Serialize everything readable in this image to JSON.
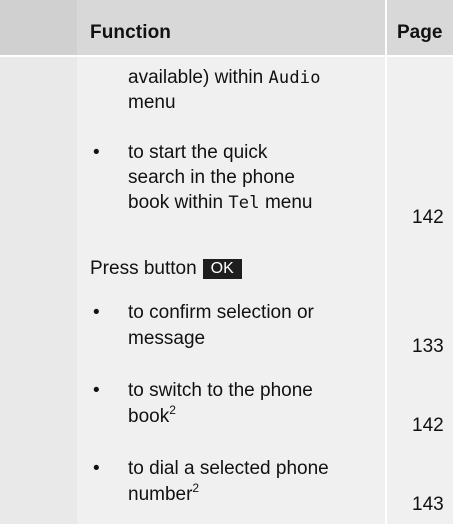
{
  "table": {
    "headers": {
      "function": "Function",
      "page": "Page"
    },
    "continued": {
      "line1": "available) within",
      "line1_mono": "Audio",
      "line2": "menu"
    },
    "quick_search": {
      "line1": "to start the quick",
      "line2": "search in the phone",
      "line3": "book within",
      "line3_mono": "Tel",
      "line3_end": "menu",
      "page": "142"
    },
    "press_button": {
      "text": "Press button",
      "button_label": "OK"
    },
    "items": [
      {
        "line1": "to confirm selection or",
        "line2": "message",
        "sup": "",
        "page": "133"
      },
      {
        "line1": "to switch to the phone",
        "line2": "book",
        "sup": "2",
        "page": "142"
      },
      {
        "line1": "to dial a selected phone",
        "line2": "number",
        "sup": "2",
        "page": "143"
      }
    ],
    "bullet": "•"
  }
}
